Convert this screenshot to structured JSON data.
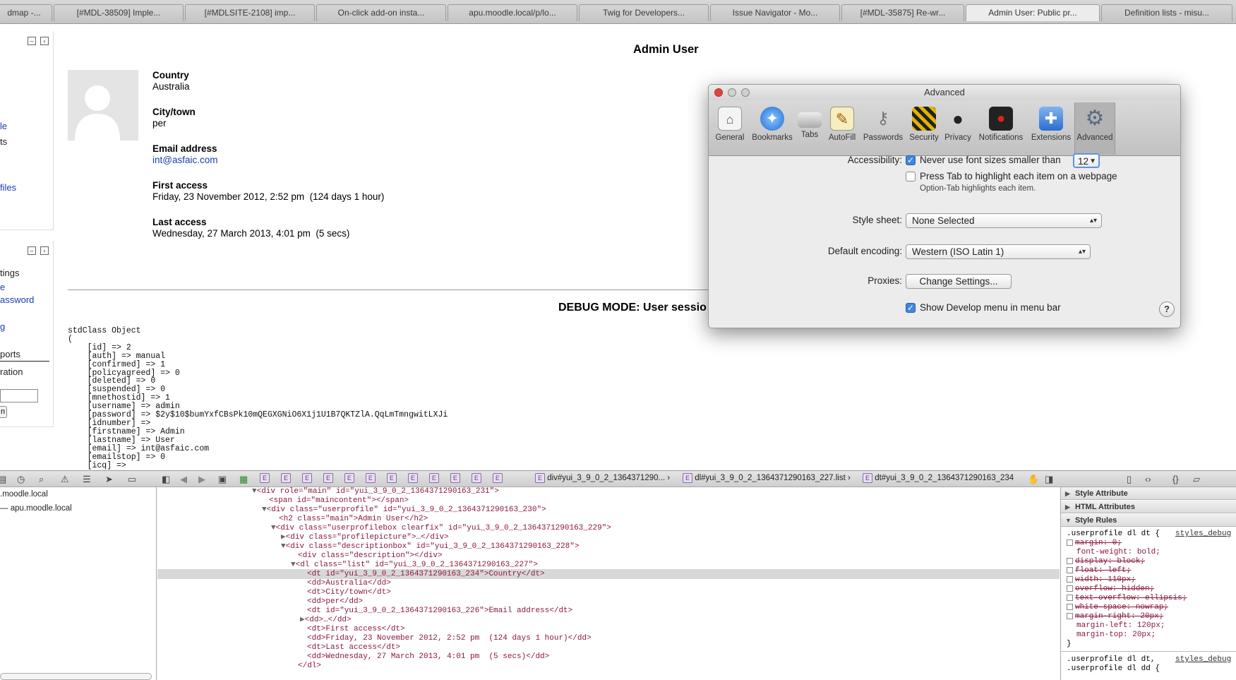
{
  "tabs": [
    {
      "label": "dmap -..."
    },
    {
      "label": "[#MDL-38509] Imple..."
    },
    {
      "label": "[#MDLSITE-2108] imp..."
    },
    {
      "label": "On-click add-on insta..."
    },
    {
      "label": "apu.moodle.local/p/lo..."
    },
    {
      "label": "Twig for Developers..."
    },
    {
      "label": "Issue Navigator - Mo..."
    },
    {
      "label": "[#MDL-35875] Re-wr..."
    },
    {
      "label": "Admin User: Public pr..."
    },
    {
      "label": "Definition lists - misu..."
    }
  ],
  "sidebar": {
    "block1_links": [
      "le",
      "ts",
      "files"
    ],
    "block2_links": [
      "tings",
      "e",
      "assword",
      "g",
      "ports",
      "ration"
    ],
    "button_fragment": "n"
  },
  "profile": {
    "title": "Admin User",
    "fields": [
      {
        "label": "Country",
        "value": "Australia"
      },
      {
        "label": "City/town",
        "value": "per"
      },
      {
        "label": "Email address",
        "value": "int@asfaic.com"
      },
      {
        "label": "First access",
        "value": "Friday, 23 November 2012, 2:52 pm  (124 days 1 hour)"
      },
      {
        "label": "Last access",
        "value": "Wednesday, 27 March 2013, 4:01 pm  (5 secs)"
      }
    ],
    "debug_heading": "DEBUG MODE: User sessio",
    "dump": "stdClass Object\n(\n    [id] => 2\n    [auth] => manual\n    [confirmed] => 1\n    [policyagreed] => 0\n    [deleted] => 0\n    [suspended] => 0\n    [mnethostid] => 1\n    [username] => admin\n    [password] => $2y$10$bumYxfCBsPk10mQEGXGNiO6X1j1U1B7QKTZlA.QqLmTmngwitLXJi\n    [idnumber] =>\n    [firstname] => Admin\n    [lastname] => User\n    [email] => int@asfaic.com\n    [emailstop] => 0\n    [icq] =>"
  },
  "prefs": {
    "title": "Advanced",
    "toolbar": [
      {
        "label": "General",
        "icon": "general-icon"
      },
      {
        "label": "Bookmarks",
        "icon": "bookmarks-icon"
      },
      {
        "label": "Tabs",
        "icon": "tabs-icon"
      },
      {
        "label": "AutoFill",
        "icon": "autofill-icon"
      },
      {
        "label": "Passwords",
        "icon": "passwords-icon"
      },
      {
        "label": "Security",
        "icon": "security-icon"
      },
      {
        "label": "Privacy",
        "icon": "privacy-icon"
      },
      {
        "label": "Notifications",
        "icon": "notifications-icon"
      },
      {
        "label": "Extensions",
        "icon": "extensions-icon"
      },
      {
        "label": "Advanced",
        "icon": "advanced-gear-icon"
      }
    ],
    "accessibility_label": "Accessibility:",
    "min_font_text": "Never use font sizes smaller than",
    "min_font_value": "12",
    "tab_highlight_text": "Press Tab to highlight each item on a webpage",
    "tab_hint": "Option-Tab highlights each item.",
    "stylesheet_label": "Style sheet:",
    "stylesheet_value": "None Selected",
    "encoding_label": "Default encoding:",
    "encoding_value": "Western (ISO Latin 1)",
    "proxies_label": "Proxies:",
    "proxies_button": "Change Settings...",
    "develop_menu_text": "Show Develop menu in menu bar",
    "help": "?"
  },
  "devtools": {
    "crumbs": [
      "div#yui_3_9_0_2_1364371290...",
      "dl#yui_3_9_0_2_1364371290163_227.list",
      "dt#yui_3_9_0_2_1364371290163_234"
    ],
    "left_items": [
      ".moodle.local",
      "— apu.moodle.local"
    ],
    "dom_lines": [
      "<div role=\"main\" id=\"yui_3_9_0_2_1364371290163_231\">",
      "<span id=\"maincontent\"></span>",
      "<div class=\"userprofile\" id=\"yui_3_9_0_2_1364371290163_230\">",
      "<h2 class=\"main\">Admin User</h2>",
      "<div class=\"userprofilebox clearfix\" id=\"yui_3_9_0_2_1364371290163_229\">",
      "<div class=\"profilepicture\">…</div>",
      "<div class=\"descriptionbox\" id=\"yui_3_9_0_2_1364371290163_228\">",
      "<div class=\"description\"></div>",
      "<dl class=\"list\" id=\"yui_3_9_0_2_1364371290163_227\">",
      "<dt id=\"yui_3_9_0_2_1364371290163_234\">Country</dt>",
      "<dd>Australia</dd>",
      "<dt>City/town</dt>",
      "<dd>per</dd>",
      "<dt id=\"yui_3_9_0_2_1364371290163_226\">Email address</dt>",
      "<dd>…</dd>",
      "<dt>First access</dt>",
      "<dd>Friday, 23 November 2012, 2:52 pm  (124 days 1 hour)</dd>",
      "<dt>Last access</dt>",
      "<dd>Wednesday, 27 March 2013, 4:01 pm  (5 secs)</dd>",
      "</dl>"
    ],
    "sections": [
      "Style Attribute",
      "HTML Attributes",
      "Style Rules"
    ],
    "rule_selector": ".userprofile dl dt {",
    "rule_source": "styles_debug",
    "rule_props": [
      "margin: 0;",
      "font-weight: bold;",
      "display: block;",
      "float: left;",
      "width: 110px;",
      "overflow: hidden;",
      "text-overflow: ellipsis;",
      "white-space: nowrap;",
      "margin-right: 20px;",
      "margin-left: 120px;",
      "margin-top: 20px;"
    ],
    "rule_close": "}",
    "rule2_a": ".userprofile dl dt,",
    "rule2_b": ".userprofile dl dd {"
  },
  "colors": {
    "link": "#1a3fa8",
    "checkbox": "#3f86e0",
    "selected_row": "#d8d8d8"
  }
}
